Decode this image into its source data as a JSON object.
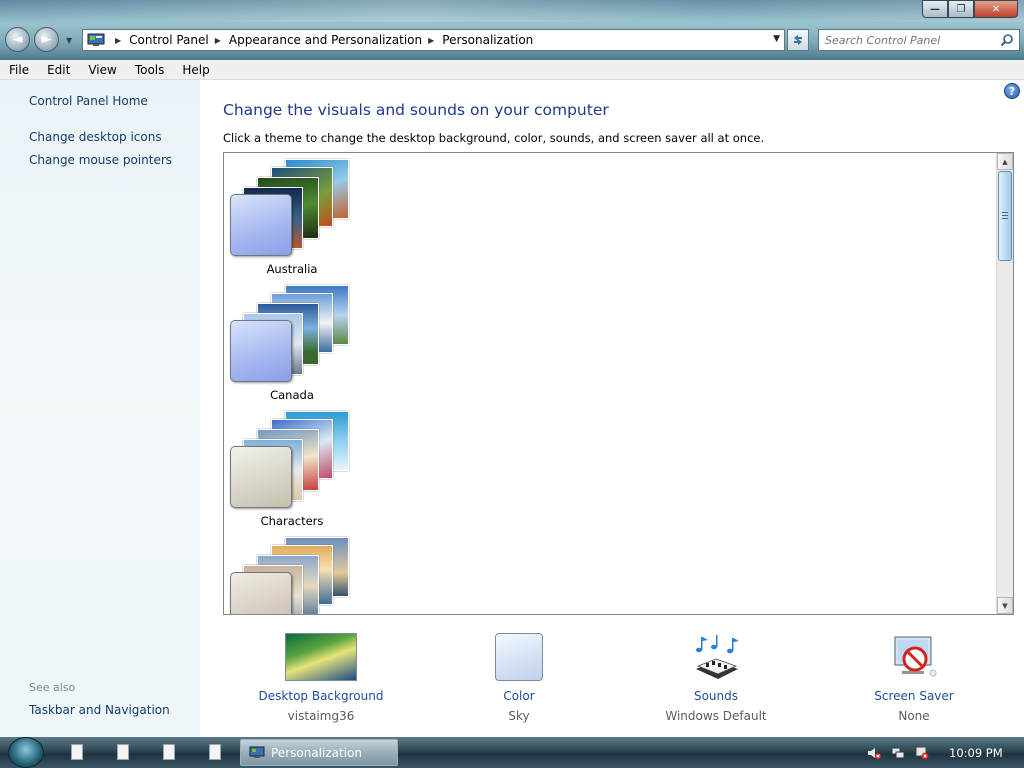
{
  "window": {
    "minimize_glyph": "—",
    "maximize_glyph": "❐",
    "close_glyph": "✕"
  },
  "nav": {
    "back_glyph": "◄",
    "forward_glyph": "►"
  },
  "address": {
    "crumbs": [
      "Control Panel",
      "Appearance and Personalization",
      "Personalization"
    ]
  },
  "search": {
    "placeholder": "Search Control Panel"
  },
  "menu": [
    "File",
    "Edit",
    "View",
    "Tools",
    "Help"
  ],
  "left_pane": {
    "home": "Control Panel Home",
    "tasks": [
      "Change desktop icons",
      "Change mouse pointers"
    ],
    "see_also_heading": "See also",
    "see_also": [
      "Taskbar and Navigation"
    ]
  },
  "main": {
    "title": "Change the visuals and sounds on your computer",
    "subtitle": "Click a theme to change the desktop background, color, sounds, and screen saver all at once.",
    "themes": [
      {
        "name": "Australia"
      },
      {
        "name": "Canada"
      },
      {
        "name": "Characters"
      },
      {
        "name": ""
      }
    ]
  },
  "tiles": [
    {
      "name": "Desktop Background",
      "value": "vistaimg36",
      "icon": "wallpaper-icon"
    },
    {
      "name": "Color",
      "value": "Sky",
      "icon": "color-swatch-icon"
    },
    {
      "name": "Sounds",
      "value": "Windows Default",
      "icon": "sounds-icon"
    },
    {
      "name": "Screen Saver",
      "value": "None",
      "icon": "screen-saver-icon"
    }
  ],
  "taskbar": {
    "task": "Personalization",
    "clock": "10:09 PM"
  },
  "colors": {
    "link": "#163c68",
    "title": "#1e3c8c",
    "tile_link": "#1c4e9c"
  }
}
